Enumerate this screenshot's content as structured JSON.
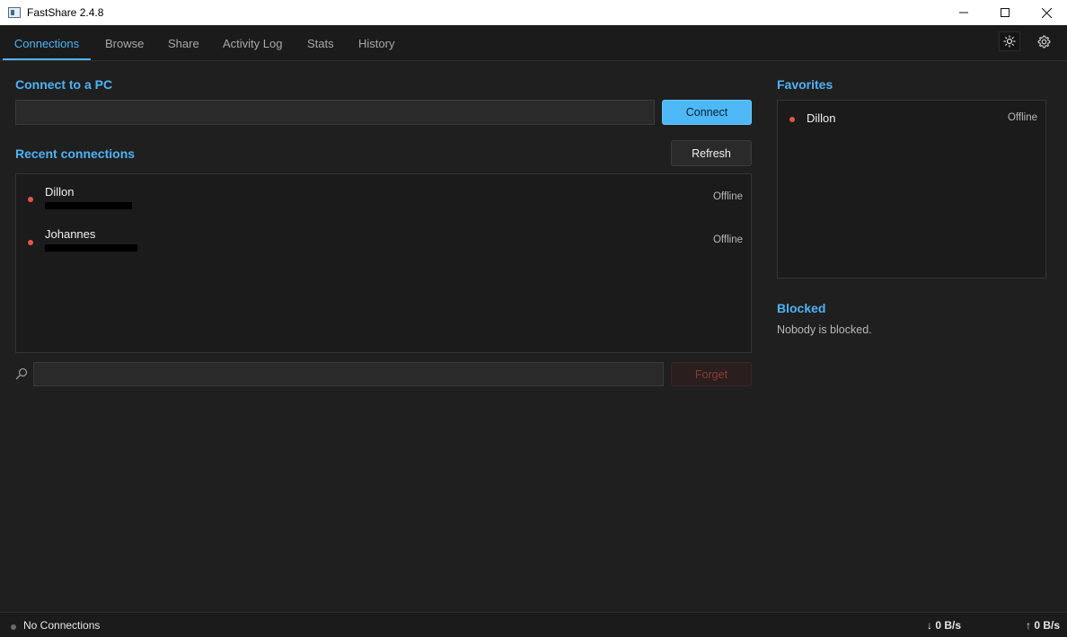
{
  "window": {
    "title": "FastShare 2.4.8"
  },
  "tabs": [
    {
      "label": "Connections",
      "active": true
    },
    {
      "label": "Browse"
    },
    {
      "label": "Share"
    },
    {
      "label": "Activity Log"
    },
    {
      "label": "Stats"
    },
    {
      "label": "History"
    }
  ],
  "toolbar": {
    "theme_icon": "sun-icon",
    "settings_icon": "gear-icon"
  },
  "connect": {
    "title": "Connect to a PC",
    "input_value": "",
    "button_label": "Connect"
  },
  "recent": {
    "title": "Recent connections",
    "refresh_label": "Refresh",
    "items": [
      {
        "name": "Dillon",
        "status": "Offline"
      },
      {
        "name": "Johannes",
        "status": "Offline"
      }
    ],
    "search_value": "",
    "forget_label": "Forget"
  },
  "favorites": {
    "title": "Favorites",
    "items": [
      {
        "name": "Dillon",
        "status": "Offline"
      }
    ]
  },
  "blocked": {
    "title": "Blocked",
    "empty_text": "Nobody is blocked."
  },
  "statusbar": {
    "connection_text": "No Connections",
    "download_rate": "↓ 0 B/s",
    "upload_rate": "↑ 0 B/s"
  },
  "colors": {
    "accent": "#4db3f5",
    "offline_dot": "#e5534b",
    "background": "#1f1f1f"
  }
}
